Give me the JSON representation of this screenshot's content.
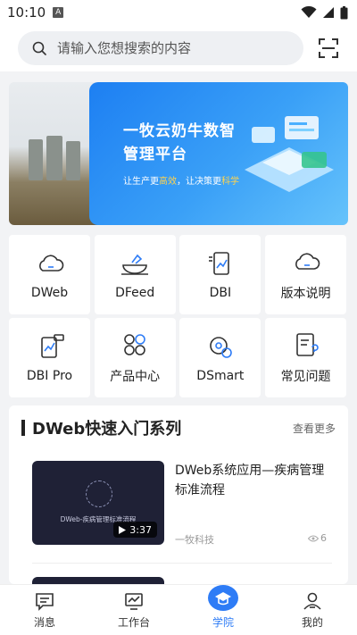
{
  "status_bar": {
    "time": "10:10",
    "indicator": "A"
  },
  "search": {
    "placeholder": "请输入您想搜索的内容"
  },
  "banner": {
    "title_line1": "一牧云奶牛数智",
    "title_line2": "管理平台",
    "subtitle_a": "让生产更",
    "subtitle_hl1": "高效",
    "subtitle_b": "，让决策更",
    "subtitle_hl2": "科学",
    "accent_color": "#ffd34e"
  },
  "grid": {
    "items": [
      {
        "label": "DWeb",
        "icon": "cloud-icon"
      },
      {
        "label": "DFeed",
        "icon": "feed-bowl-icon"
      },
      {
        "label": "DBI",
        "icon": "chart-phone-icon"
      },
      {
        "label": "版本说明",
        "icon": "cloud-icon"
      },
      {
        "label": "DBI Pro",
        "icon": "chart-pro-icon"
      },
      {
        "label": "产品中心",
        "icon": "apps-icon"
      },
      {
        "label": "DSmart",
        "icon": "gear-eye-icon"
      },
      {
        "label": "常见问题",
        "icon": "faq-icon"
      }
    ]
  },
  "section": {
    "title": "DWeb快速入门系列",
    "more": "查看更多",
    "video": {
      "title": "DWeb系统应用—疾病管理标准流程",
      "thumb_caption": "DWeb-疾病管理标准流程",
      "duration": "3:37",
      "author": "一牧科技",
      "views": "6"
    }
  },
  "tabbar": {
    "tabs": [
      {
        "label": "消息",
        "icon": "message-icon"
      },
      {
        "label": "工作台",
        "icon": "monitor-chart-icon"
      },
      {
        "label": "学院",
        "icon": "graduation-cap-icon",
        "active": true
      },
      {
        "label": "我的",
        "icon": "user-icon"
      }
    ],
    "active_color": "#2e7cf6"
  }
}
